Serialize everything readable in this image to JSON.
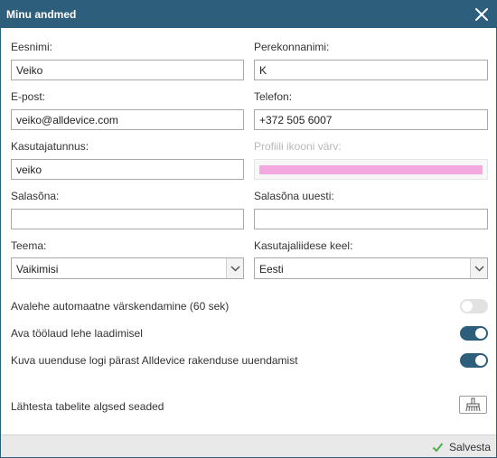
{
  "dialog": {
    "title": "Minu andmed"
  },
  "form": {
    "first_name": {
      "label": "Eesnimi:",
      "value": "Veiko"
    },
    "last_name": {
      "label": "Perekonnanimi:",
      "value": "K"
    },
    "email": {
      "label": "E-post:",
      "value": "veiko@alldevice.com"
    },
    "phone": {
      "label": "Telefon:",
      "value": "+372 505 6007"
    },
    "username": {
      "label": "Kasutajatunnus:",
      "value": "veiko"
    },
    "icon_color": {
      "label": "Profiili ikooni värv:",
      "color": "#f4a8e0"
    },
    "password": {
      "label": "Salasõna:",
      "value": ""
    },
    "password_repeat": {
      "label": "Salasõna uuesti:",
      "value": ""
    },
    "theme": {
      "label": "Teema:",
      "value": "Vaikimisi"
    },
    "language": {
      "label": "Kasutajaliidese keel:",
      "value": "Eesti"
    }
  },
  "toggles": [
    {
      "label": "Avalehe automaatne värskendamine (60 sek)",
      "on": false
    },
    {
      "label": "Ava töölaud lehe laadimisel",
      "on": true
    },
    {
      "label": "Kuva uuenduse logi pärast Alldevice rakenduse uuendamist",
      "on": true
    }
  ],
  "reset": {
    "label": "Lähtesta tabelite algsed seaded",
    "icon": "broom-icon"
  },
  "footer": {
    "save_label": "Salvesta",
    "save_icon": "checkmark-icon"
  },
  "colors": {
    "accent": "#2d5f7c",
    "save_check": "#4caf50"
  }
}
